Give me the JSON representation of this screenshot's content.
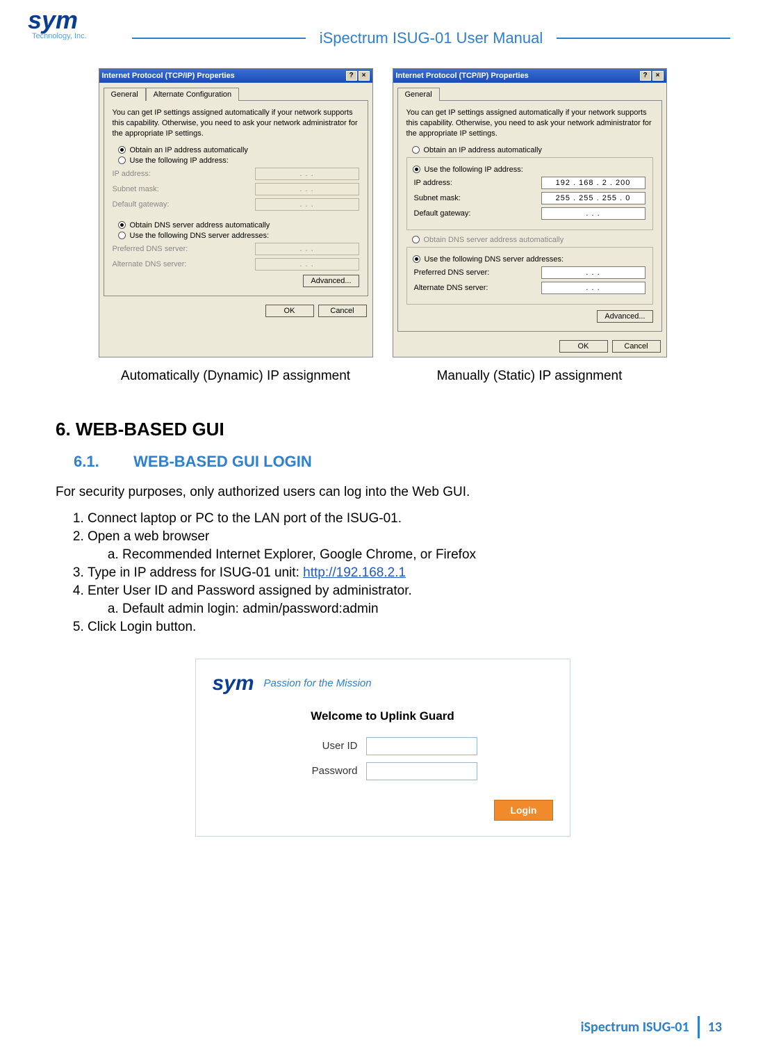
{
  "header": {
    "logo_main": "sym",
    "logo_sub": "Technology, Inc.",
    "doc_title": "iSpectrum ISUG-01 User Manual"
  },
  "dialogs": {
    "left": {
      "title": "Internet Protocol (TCP/IP) Properties",
      "help_btn": "?",
      "close_btn": "×",
      "tab_general": "General",
      "tab_alt": "Alternate Configuration",
      "desc": "You can get IP settings assigned automatically if your network supports this capability. Otherwise, you need to ask your network administrator for the appropriate IP settings.",
      "r1": "Obtain an IP address automatically",
      "r2": "Use the following IP address:",
      "ip_label": "IP address:",
      "subnet_label": "Subnet mask:",
      "gw_label": "Default gateway:",
      "r3": "Obtain DNS server address automatically",
      "r4": "Use the following DNS server addresses:",
      "pref_dns": "Preferred DNS server:",
      "alt_dns": "Alternate DNS server:",
      "advanced": "Advanced...",
      "ok": "OK",
      "cancel": "Cancel",
      "ip_val": ".       .       .",
      "subnet_val": ".       .       .",
      "gw_val": ".       .       .",
      "pdns_val": ".       .       .",
      "adns_val": ".       .       ."
    },
    "right": {
      "title": "Internet Protocol (TCP/IP) Properties",
      "help_btn": "?",
      "close_btn": "×",
      "tab_general": "General",
      "desc": "You can get IP settings assigned automatically if your network supports this capability. Otherwise, you need to ask your network administrator for the appropriate IP settings.",
      "r1": "Obtain an IP address automatically",
      "r2": "Use the following IP address:",
      "ip_label": "IP address:",
      "subnet_label": "Subnet mask:",
      "gw_label": "Default gateway:",
      "r3": "Obtain DNS server address automatically",
      "r4": "Use the following DNS server addresses:",
      "pref_dns": "Preferred DNS server:",
      "alt_dns": "Alternate DNS server:",
      "advanced": "Advanced...",
      "ok": "OK",
      "cancel": "Cancel",
      "ip_val": "192 . 168 .  2  . 200",
      "subnet_val": "255 . 255 . 255 .  0",
      "gw_val": ".       .       .",
      "pdns_val": ".       .       .",
      "adns_val": ".       .       ."
    },
    "caption_left": "Automatically (Dynamic) IP assignment",
    "caption_right": "Manually (Static) IP assignment"
  },
  "section": {
    "h2": "6. WEB-BASED GUI",
    "h3_num": "6.1.",
    "h3_text": "WEB-BASED GUI LOGIN",
    "intro": "For security purposes, only authorized users can log into the Web GUI.",
    "steps": {
      "s1": "Connect laptop or PC to the LAN port of the ISUG-01.",
      "s2": "Open a web browser",
      "s2a": "Recommended Internet Explorer, Google Chrome, or Firefox",
      "s3_pre": "Type in IP address for ISUG-01 unit: ",
      "s3_link": "http://192.168.2.1",
      "s4": "Enter User ID and Password assigned by administrator.",
      "s4a": "Default admin login: admin/password:admin",
      "s5": "Click Login button."
    }
  },
  "login": {
    "logo_main": "sym",
    "tagline": "Passion for the Mission",
    "welcome": "Welcome to Uplink Guard",
    "user_label": "User ID",
    "pass_label": "Password",
    "button": "Login"
  },
  "footer": {
    "name": "iSpectrum ISUG-01",
    "page": "13"
  }
}
